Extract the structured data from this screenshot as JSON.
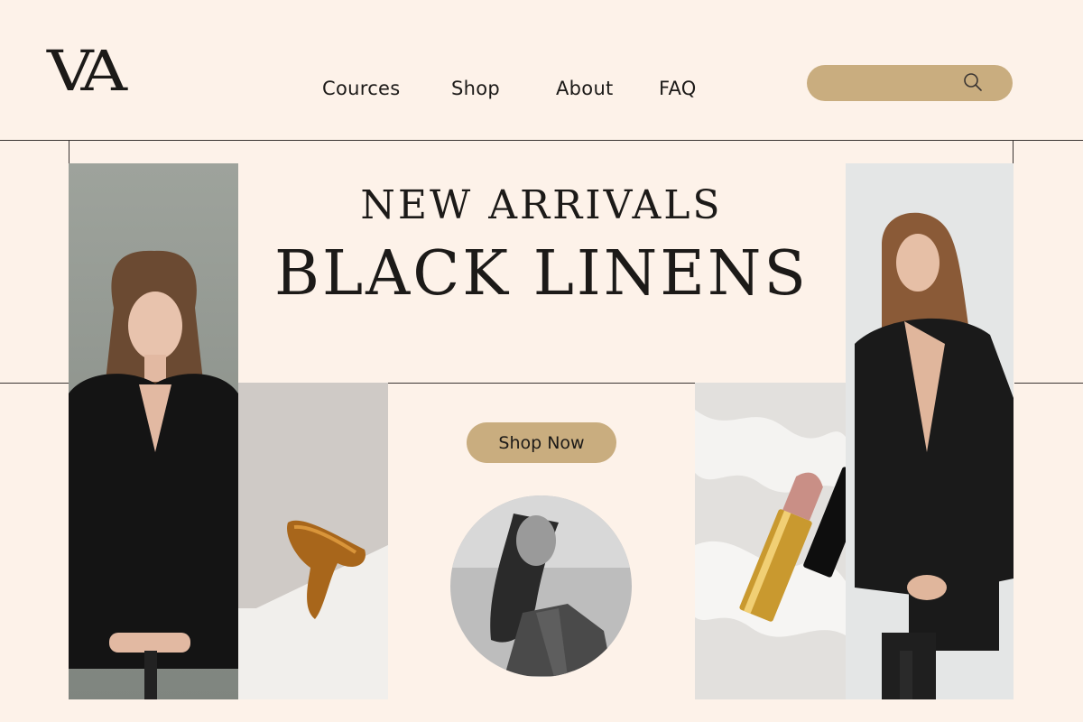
{
  "brand": {
    "logo_text": "VA"
  },
  "nav": {
    "items": [
      {
        "label": "Cources"
      },
      {
        "label": "Shop"
      },
      {
        "label": "About"
      },
      {
        "label": "FAQ"
      }
    ]
  },
  "search": {
    "placeholder": "",
    "value": "",
    "icon": "search-icon"
  },
  "hero": {
    "subtitle": "NEW ARRIVALS",
    "title": "BLACK LINENS",
    "cta_label": "Shop Now"
  },
  "images": [
    {
      "name": "model-black-blazer-left",
      "icon": "photo"
    },
    {
      "name": "amber-hair-claw-clip",
      "icon": "photo"
    },
    {
      "name": "woman-bw-portrait",
      "icon": "photo"
    },
    {
      "name": "lipstick-on-satin",
      "icon": "photo"
    },
    {
      "name": "model-black-blazer-right",
      "icon": "photo"
    }
  ],
  "colors": {
    "background": "#fdf2e9",
    "accent": "#c9ad7f",
    "text": "#1c1a18",
    "lines": "#3a3532"
  }
}
